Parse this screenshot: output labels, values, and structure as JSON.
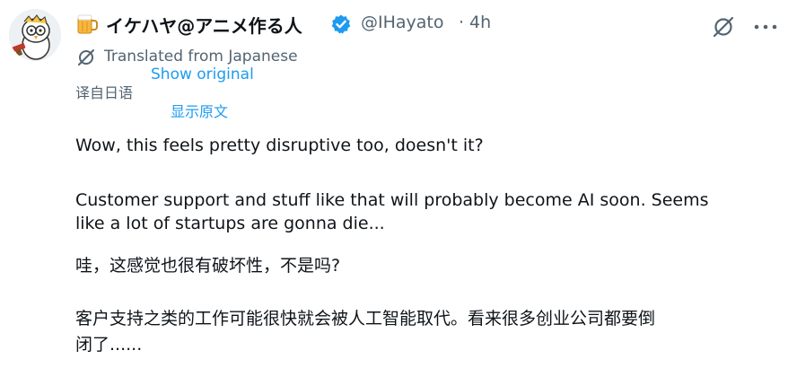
{
  "tweet": {
    "display_name": "イケハヤ@アニメ作る人",
    "handle": "@IHayato",
    "separator": "·",
    "time": "4h",
    "translated_from": "Translated from Japanese",
    "show_original": "Show original",
    "translated_from_cn": "译自日语",
    "show_original_cn": "显示原文",
    "text_en_line1": "Wow, this feels pretty disruptive too, doesn't it?",
    "text_en_line2": "Customer support and stuff like that will probably become AI soon. Seems",
    "text_en_line3": "like a lot of startups are gonna die...",
    "text_cn_line1": "哇，这感觉也很有破坏性，不是吗?",
    "text_cn_line2": "客户支持之类的工作可能很快就会被人工智能取代。看来很多创业公司都要倒",
    "text_cn_line3": "闭了......"
  },
  "colors": {
    "text_primary": "#0f1419",
    "text_secondary": "#536471",
    "link": "#1d9bf0",
    "verified": "#1d9bf0"
  },
  "icons": {
    "avatar": "cartoon-bird-avatar",
    "name_emoji": "beer-mug-icon",
    "verified": "verified-badge-icon",
    "translate": "translate-icon",
    "grok": "grok-icon",
    "more": "more-icon"
  }
}
